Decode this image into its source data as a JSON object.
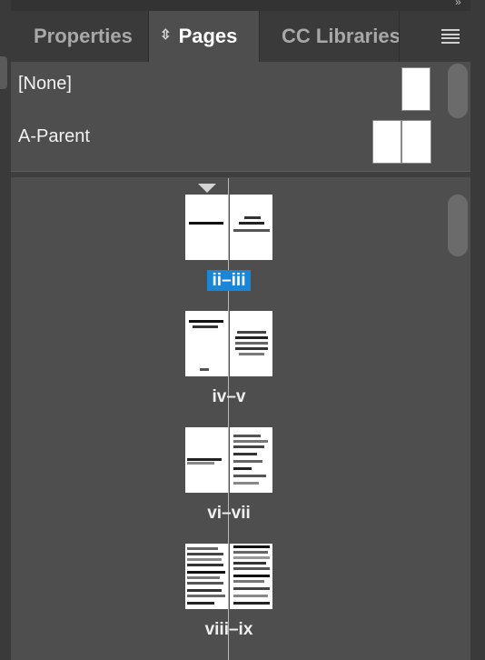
{
  "tabs": [
    {
      "label": "Properties",
      "active": false
    },
    {
      "label": "Pages",
      "active": true
    },
    {
      "label": "CC Libraries",
      "active": false
    }
  ],
  "icons": {
    "sort": "sort-icon",
    "menu": "panel-menu-icon",
    "collapse": "collapse-panel-icon"
  },
  "parents": [
    {
      "label": "[None]",
      "pages": 1
    },
    {
      "label": "A-Parent",
      "pages": 2
    }
  ],
  "spreads": [
    {
      "label": "ii–iii",
      "selected": true,
      "current": true
    },
    {
      "label": "iv–v",
      "selected": false,
      "current": false
    },
    {
      "label": "vi–vii",
      "selected": false,
      "current": false
    },
    {
      "label": "viii–ix",
      "selected": false,
      "current": false
    }
  ],
  "colors": {
    "selection": "#1a86d8",
    "panel": "#4e4e4e"
  }
}
